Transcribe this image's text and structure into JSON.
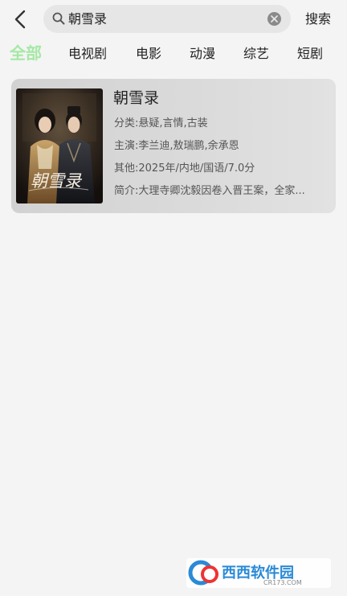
{
  "header": {
    "search_query": "朝雪录",
    "search_button": "搜索"
  },
  "tabs": [
    {
      "label": "全部",
      "active": true
    },
    {
      "label": "电视剧"
    },
    {
      "label": "电影"
    },
    {
      "label": "动漫"
    },
    {
      "label": "综艺"
    },
    {
      "label": "短剧"
    }
  ],
  "results": [
    {
      "title": "朝雪录",
      "poster_title": "朝雪录",
      "category_label": "分类:",
      "category_value": "悬疑,言情,古装",
      "cast_label": "主演:",
      "cast_value": "李兰迪,敖瑞鹏,余承恩",
      "other_label": "其他:",
      "other_value": "2025年/内地/国语/7.0分",
      "intro_label": "简介:",
      "intro_value": "大理寺卿沈毅因卷入晋王案，全家..."
    }
  ],
  "watermark": {
    "text": "西西软件园",
    "sub": "CR173.COM"
  },
  "colors": {
    "accent_tab": "#a6e8a6",
    "background": "#f4f4f4"
  },
  "icons": [
    "back-arrow-icon",
    "search-icon",
    "clear-icon"
  ]
}
